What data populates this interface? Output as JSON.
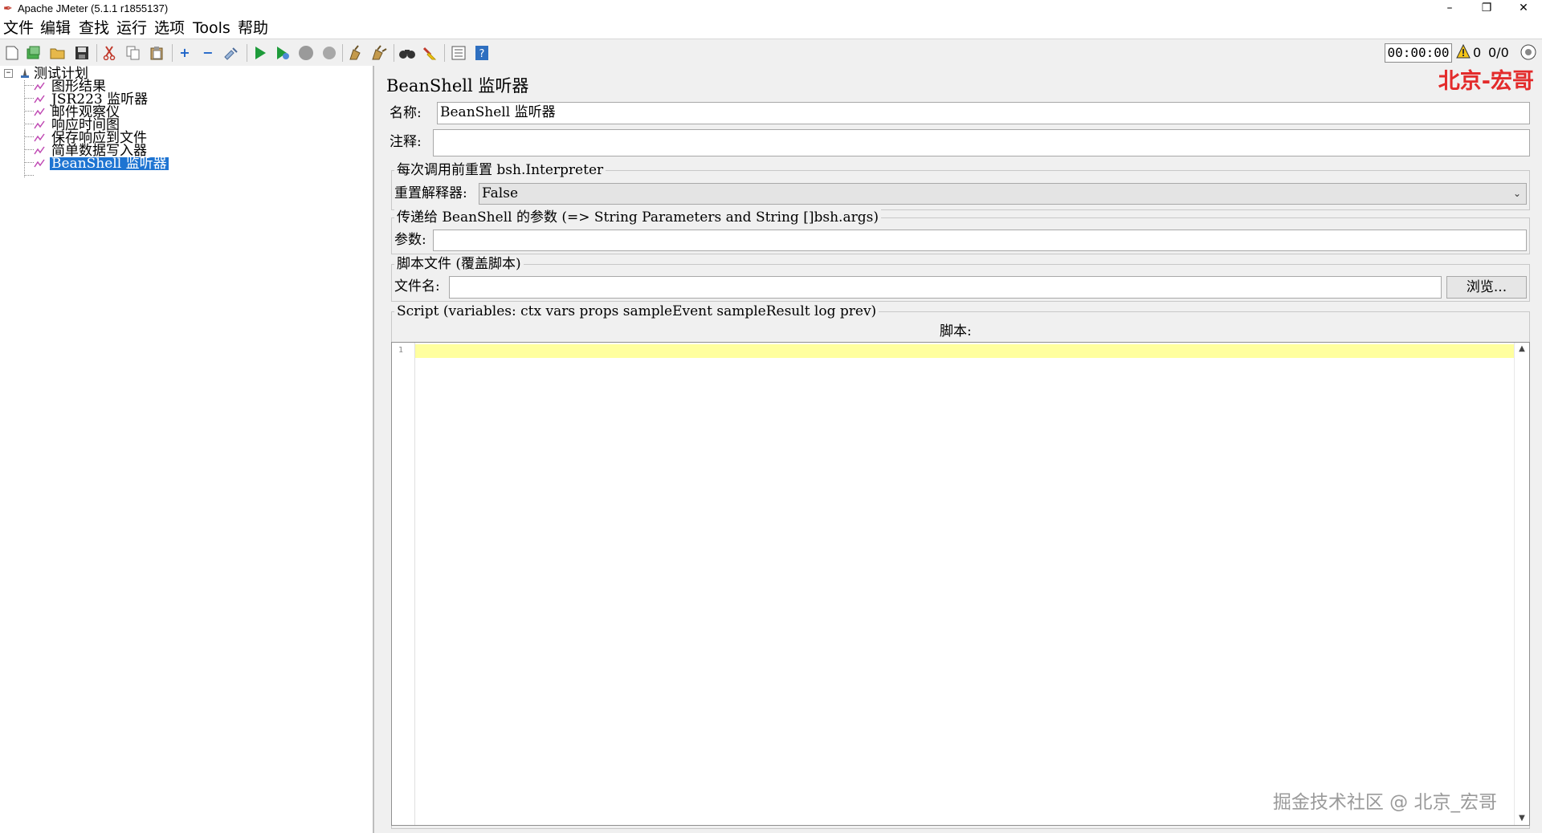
{
  "window": {
    "title": "Apache JMeter (5.1.1 r1855137)",
    "controls": {
      "minimize": "–",
      "restore": "❐",
      "close": "✕"
    }
  },
  "menu": [
    "文件",
    "编辑",
    "查找",
    "运行",
    "选项",
    "Tools",
    "帮助"
  ],
  "toolbar": {
    "timer": "00:00:00",
    "warning_count": "0",
    "thread_count": "0/0"
  },
  "tree": {
    "root": "测试计划",
    "items": [
      "图形结果",
      "JSR223 监听器",
      "邮件观察仪",
      "响应时间图",
      "保存响应到文件",
      "简单数据写入器",
      "BeanShell 监听器"
    ],
    "selected_index": 6
  },
  "panel": {
    "title": "BeanShell 监听器",
    "watermark_top": "北京-宏哥",
    "name_label": "名称:",
    "name_value": "BeanShell 监听器",
    "comment_label": "注释:",
    "comment_value": "",
    "reset_group_title": "每次调用前重置 bsh.Interpreter",
    "reset_label": "重置解释器:",
    "reset_value": "False",
    "params_group_title": "传递给 BeanShell 的参数 (=> String Parameters and String []bsh.args)",
    "params_label": "参数:",
    "params_value": "",
    "file_group_title": "脚本文件 (覆盖脚本)",
    "file_label": "文件名:",
    "file_value": "",
    "browse_label": "浏览...",
    "script_group_title": "Script (variables: ctx vars props sampleEvent sampleResult log prev)",
    "script_label": "脚本:",
    "line_number": "1",
    "watermark_bottom": "掘金技术社区 @ 北京_宏哥"
  }
}
